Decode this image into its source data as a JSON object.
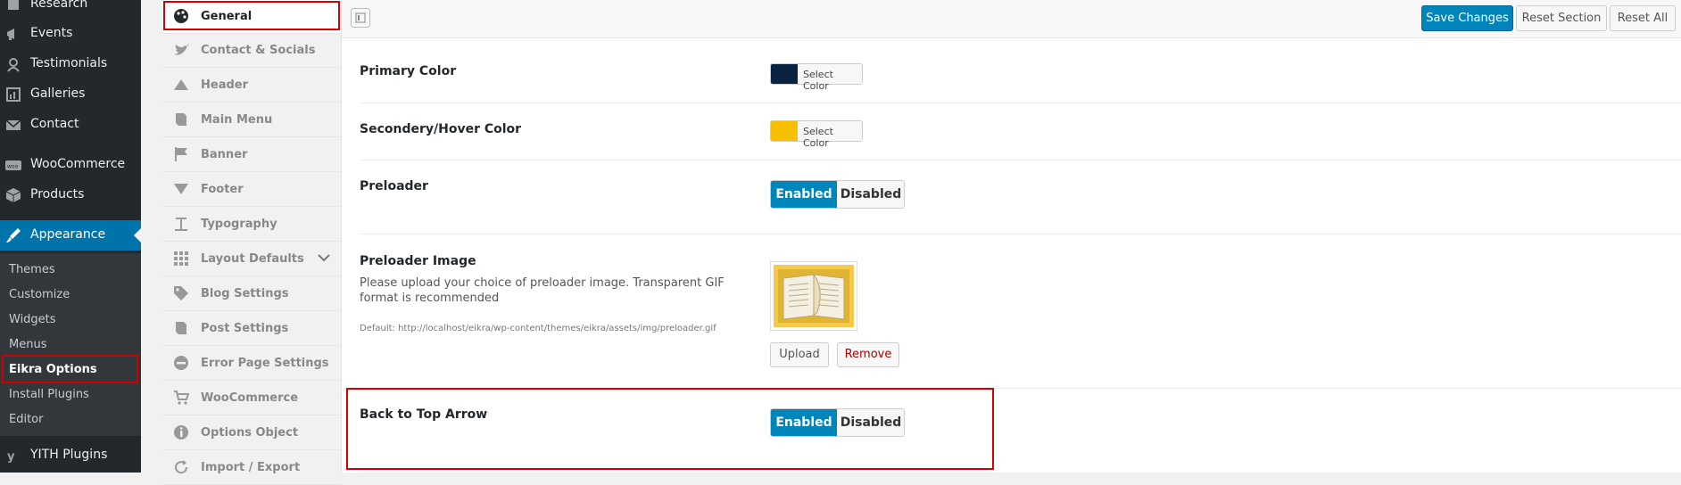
{
  "wp_menu": {
    "items": [
      {
        "label": "Research",
        "icon": "research-icon"
      },
      {
        "label": "Events",
        "icon": "megaphone-icon"
      },
      {
        "label": "Testimonials",
        "icon": "testimonials-icon"
      },
      {
        "label": "Galleries",
        "icon": "gallery-icon"
      },
      {
        "label": "Contact",
        "icon": "email-icon"
      },
      {
        "label": "WooCommerce",
        "icon": "woo-icon"
      },
      {
        "label": "Products",
        "icon": "box-icon"
      },
      {
        "label": "Appearance",
        "icon": "brush-icon"
      },
      {
        "label": "YITH Plugins",
        "icon": "yith-icon"
      }
    ],
    "submenu": [
      "Themes",
      "Customize",
      "Widgets",
      "Menus",
      "Eikra Options",
      "Install Plugins",
      "Editor"
    ]
  },
  "options_sidebar": {
    "items": [
      {
        "label": "General",
        "icon": "palette-icon"
      },
      {
        "label": "Contact & Socials",
        "icon": "twitter-icon"
      },
      {
        "label": "Header",
        "icon": "triangle-up-icon"
      },
      {
        "label": "Main Menu",
        "icon": "book-icon"
      },
      {
        "label": "Banner",
        "icon": "flag-icon"
      },
      {
        "label": "Footer",
        "icon": "triangle-down-icon"
      },
      {
        "label": "Typography",
        "icon": "text-icon"
      },
      {
        "label": "Layout Defaults",
        "icon": "grid-icon"
      },
      {
        "label": "Blog Settings",
        "icon": "tags-icon"
      },
      {
        "label": "Post Settings",
        "icon": "book-icon"
      },
      {
        "label": "Error Page Settings",
        "icon": "minus-circle-icon"
      },
      {
        "label": "WooCommerce",
        "icon": "cart-icon"
      },
      {
        "label": "Options Object",
        "icon": "info-icon"
      },
      {
        "label": "Import / Export",
        "icon": "refresh-icon"
      }
    ]
  },
  "toolbar": {
    "save_label": "Save Changes",
    "reset_section_label": "Reset Section",
    "reset_all_label": "Reset All"
  },
  "settings": {
    "primary_color": {
      "title": "Primary Color",
      "button": "Select Color",
      "swatch": "#0a2342"
    },
    "hover_color": {
      "title": "Secondery/Hover Color",
      "button": "Select Color",
      "swatch": "#f6c000"
    },
    "preloader": {
      "title": "Preloader",
      "on": "Enabled",
      "off": "Disabled"
    },
    "preloader_image": {
      "title": "Preloader Image",
      "desc": "Please upload your choice of preloader image. Transparent GIF format is recommended",
      "default": "Default: http://localhost/eikra/wp-content/themes/eikra/assets/img/preloader.gif",
      "upload": "Upload",
      "remove": "Remove"
    },
    "back_to_top": {
      "title": "Back to Top Arrow",
      "on": "Enabled",
      "off": "Disabled"
    }
  },
  "colors": {
    "accent": "#0085ba",
    "highlight": "#d40000"
  }
}
